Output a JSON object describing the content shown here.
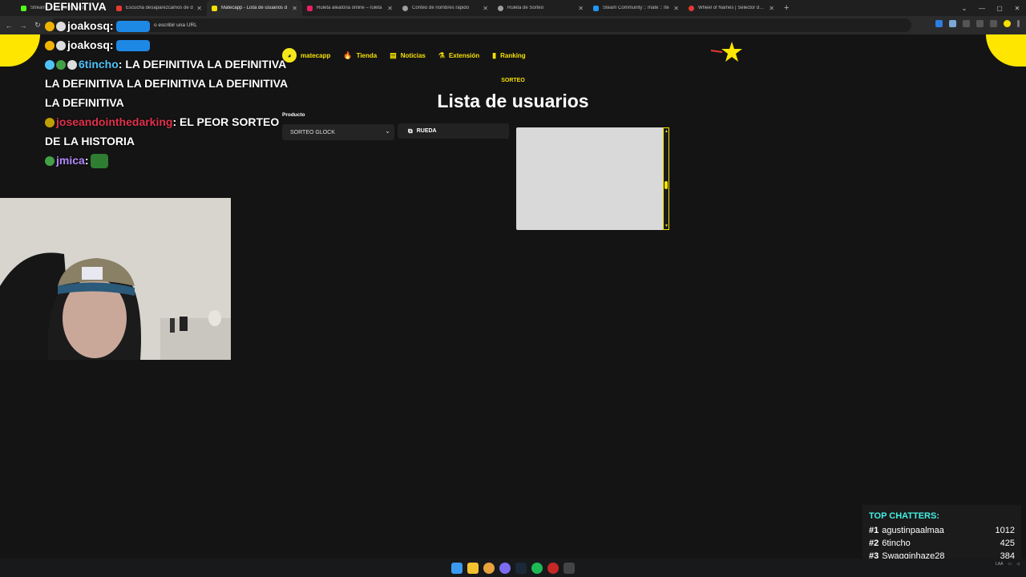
{
  "browser": {
    "tabs": [
      {
        "title": "Stream - Kick Dashboard",
        "color": "#53fc18",
        "active": false
      },
      {
        "title": "Escucha desaparezcamos de d",
        "color": "#e53935",
        "active": false
      },
      {
        "title": "Matecapp - Lista de usuarios d",
        "color": "#f5e100",
        "active": true
      },
      {
        "title": "Ruleta aleatoria online – ruleta",
        "color": "#e91e63",
        "active": false
      },
      {
        "title": "Conteo de nombres rápido",
        "color": "#9e9e9e",
        "active": false
      },
      {
        "title": "Ruleta de Sorteo",
        "color": "#9e9e9e",
        "active": false
      },
      {
        "title": "Steam Community :: mate :: Ite",
        "color": "#2196f3",
        "active": false
      },
      {
        "title": "Wheel of Names | Selector de n",
        "color": "#e53935",
        "active": false
      }
    ],
    "address_placeholder": "o escribir una URL"
  },
  "site": {
    "nav": [
      {
        "label": "matecapp",
        "icon": "matecapp-logo"
      },
      {
        "label": "Tienda",
        "icon": "fire-icon"
      },
      {
        "label": "Noticias",
        "icon": "news-icon"
      },
      {
        "label": "Extensión",
        "icon": "flask-icon"
      },
      {
        "label": "Ranking",
        "icon": "bar-chart-icon"
      }
    ],
    "section_label": "SORTEO",
    "title": "Lista de usuarios",
    "product_label": "Producto",
    "product_selected": "SORTEO GLOCK",
    "rueda_label": "RUEDA",
    "accent": "#f5e100"
  },
  "chat": [
    {
      "user": "",
      "text": "DEFINITIVA"
    },
    {
      "user": "joakosq",
      "user_color": "#ffffff",
      "text": ":"
    },
    {
      "user": "joakosq",
      "user_color": "#ffffff",
      "text": ":"
    },
    {
      "user": "6tincho",
      "user_color": "#ffffff",
      "text": ": LA DEFINITIVA LA DEFINITIVA LA DEFINITIVA LA DEFINITIVA LA DEFINITIVA LA DEFINITIVA"
    },
    {
      "user": "joseandointhedarking",
      "user_color": "#e0314b",
      "text": ": EL PEOR SORTEO DE LA HISTORIA"
    },
    {
      "user": "jmica",
      "user_color": "#b388ff",
      "text": ":"
    }
  ],
  "top_chatters": {
    "title": "TOP CHATTERS:",
    "rows": [
      {
        "rank": "#1",
        "name": "agustinpaalmaa",
        "count": "1012"
      },
      {
        "rank": "#2",
        "name": "6tincho",
        "count": "425"
      },
      {
        "rank": "#3",
        "name": "Swagginhaze28",
        "count": "384"
      }
    ]
  },
  "tray": {
    "lang": "LAA"
  }
}
